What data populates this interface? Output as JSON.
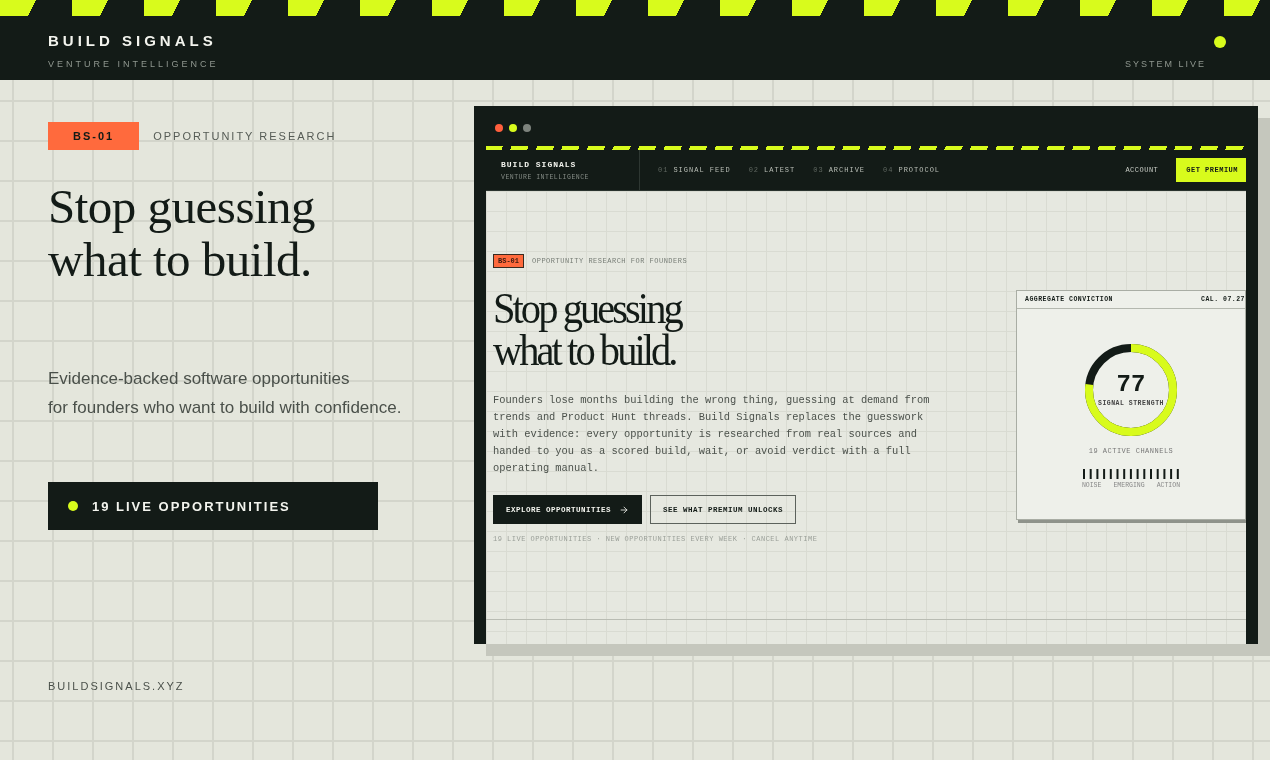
{
  "header": {
    "brand": "BUILD SIGNALS",
    "tagline": "VENTURE INTELLIGENCE",
    "status": "SYSTEM LIVE"
  },
  "hero": {
    "tag": "BS-01",
    "eyebrow": "OPPORTUNITY RESEARCH",
    "title_lines": [
      "Stop guessing",
      "what to build."
    ],
    "subtitle_lines": [
      "Evidence-backed software opportunities",
      "for founders who want to build with confidence."
    ],
    "cta": "19 LIVE OPPORTUNITIES"
  },
  "preview": {
    "nav": {
      "brand": "BUILD SIGNALS",
      "tagline": "VENTURE INTELLIGENCE",
      "links": [
        {
          "num": "01",
          "label": "SIGNAL FEED"
        },
        {
          "num": "02",
          "label": "LATEST"
        },
        {
          "num": "03",
          "label": "ARCHIVE"
        },
        {
          "num": "04",
          "label": "PROTOCOL"
        }
      ],
      "account": "ACCOUNT",
      "premium": "GET PREMIUM"
    },
    "tag": "BS-01",
    "eyebrow": "OPPORTUNITY RESEARCH FOR FOUNDERS",
    "title_lines": [
      "Stop guessing",
      "what to build."
    ],
    "body": "Founders lose months building the wrong thing, guessing at demand from trends and Product Hunt threads. Build Signals replaces the guesswork with evidence: every opportunity is researched from real sources and handed to you as a scored build, wait, or avoid verdict with a full operating manual.",
    "buttons": [
      {
        "label": "EXPLORE OPPORTUNITIES",
        "kind": "primary"
      },
      {
        "label": "SEE WHAT PREMIUM UNLOCKS",
        "kind": "outline"
      }
    ],
    "footnote": "19 LIVE OPPORTUNITIES · NEW OPPORTUNITIES EVERY WEEK · CANCEL ANYTIME",
    "card": {
      "title": "AGGREGATE CONVICTION",
      "date": "CAL. 07.27",
      "score": "77",
      "level": 0.77,
      "score_label": "SIGNAL STRENGTH",
      "channels": "19 ACTIVE CHANNELS",
      "scale": [
        "NOISE",
        "EMERGING",
        "ACTION"
      ]
    }
  },
  "footer_url": "BUILDSIGNALS.XYZ"
}
